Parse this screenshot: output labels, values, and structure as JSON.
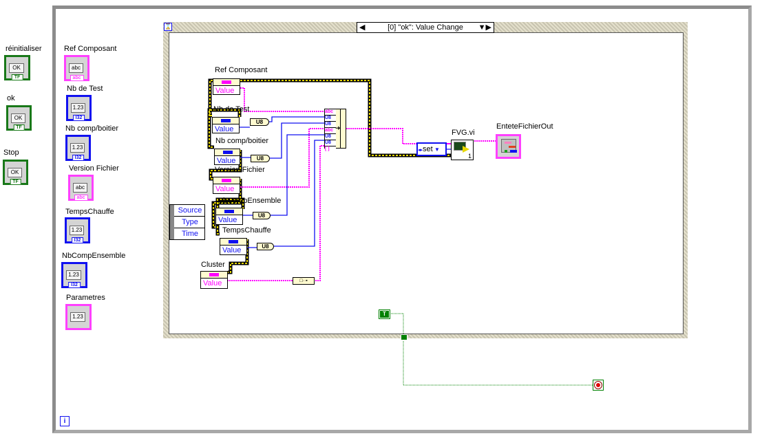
{
  "controls_left": [
    {
      "label": "réinitialiser",
      "type": "boolean",
      "tag": "TF",
      "button": "OK"
    },
    {
      "label": "ok",
      "type": "boolean",
      "tag": "TF",
      "button": "OK"
    },
    {
      "label": "Stop",
      "type": "boolean",
      "tag": "TF",
      "button": "OK"
    }
  ],
  "controls_mid": [
    {
      "label": "Ref Composant",
      "type": "string",
      "display": "abc",
      "tag": "abc"
    },
    {
      "label": "Nb de Test",
      "type": "numeric",
      "display": "1.23",
      "tag": "I32"
    },
    {
      "label": "Nb comp/boitier",
      "type": "numeric",
      "display": "1.23",
      "tag": "I32"
    },
    {
      "label": "Version Fichier",
      "type": "string",
      "display": "abc",
      "tag": "abc"
    },
    {
      "label": "TempsChauffe",
      "type": "numeric",
      "display": "1.23",
      "tag": "I32"
    },
    {
      "label": "NbCompEnsemble",
      "type": "numeric",
      "display": "1.23",
      "tag": "I32"
    },
    {
      "label": "Parametres",
      "type": "cluster",
      "display": "1.23",
      "tag": ""
    }
  ],
  "event_structure": {
    "selector": "[0] \"ok\": Value Change",
    "event_data": [
      "Source",
      "Type",
      "Time"
    ]
  },
  "property_nodes": [
    {
      "label": "Ref Composant",
      "property": "Value",
      "color": "#ff00ff"
    },
    {
      "label": "Nb de Test",
      "property": "Value",
      "color": "#1010f0"
    },
    {
      "label": "Nb comp/boitier",
      "property": "Value",
      "color": "#1010f0"
    },
    {
      "label": "Version Fichier",
      "property": "Value",
      "color": "#ff00ff"
    },
    {
      "label": "NbCompEnsemble",
      "property": "Value",
      "color": "#1010f0"
    },
    {
      "label": "TempsChauffe",
      "property": "Value",
      "color": "#1010f0"
    },
    {
      "label": "Cluster",
      "property": "Value",
      "color": "#ff00ff"
    }
  ],
  "conversion_label": "U8",
  "bundle_inputs": [
    "abc",
    "U8",
    "U8",
    "abc",
    "U8",
    "U8",
    "[ ]"
  ],
  "enum_constant": "set",
  "subvi": {
    "label": "FVG.vi",
    "count": "1"
  },
  "indicator": {
    "label": "EnteteFichierOut"
  },
  "bool_constant": "T",
  "colors": {
    "string_wire": "#ff00ff",
    "numeric_wire": "#1010f0",
    "error_wire": "#c8b400",
    "boolean_wire": "#008000"
  }
}
